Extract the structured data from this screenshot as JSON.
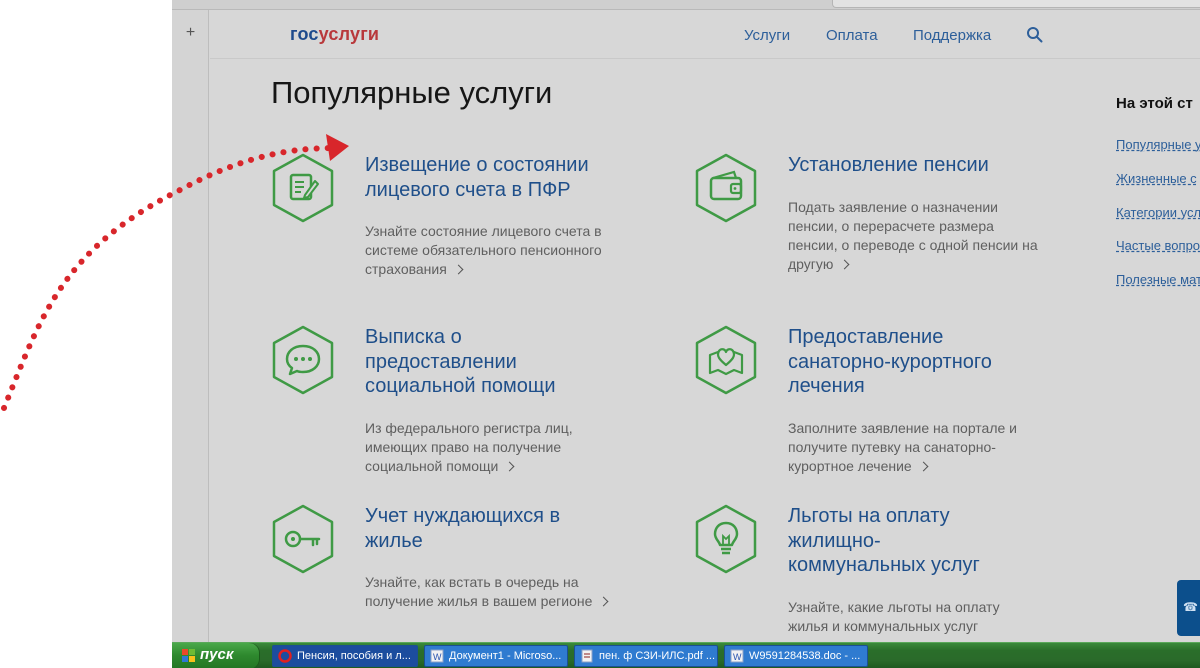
{
  "header": {
    "logo_left": "гос",
    "logo_right": "услуги",
    "nav": [
      "Услуги",
      "Оплата",
      "Поддержка"
    ],
    "search_icon": "search-icon"
  },
  "page_title": "Популярные услуги",
  "cards": [
    {
      "icon": "document-edit-icon",
      "title": "Извещение о состоянии лицевого счета в ПФР",
      "desc": "Узнайте состояние лицевого счета в системе обязательного пенсионного страхования"
    },
    {
      "icon": "wallet-icon",
      "title": "Установление пенсии",
      "desc": "Подать заявление о назначении пенсии, о перерасчете размера пенсии, о переводе с одной пенсии на другую"
    },
    {
      "icon": "chat-bubble-icon",
      "title": "Выписка о предоставлении социальной помощи",
      "desc": "Из федерального регистра лиц, имеющих право на получение социальной помощи"
    },
    {
      "icon": "heart-map-icon",
      "title": "Предоставление санаторно-курортного лечения",
      "desc": "Заполните заявление на портале и получите путевку на санаторно-курортное лечение"
    },
    {
      "icon": "key-icon",
      "title": "Учет нуждающихся в жилье",
      "desc": "Узнайте, как встать в очередь на получение жилья в вашем регионе"
    },
    {
      "icon": "lightbulb-icon",
      "title": "Льготы на оплату жилищно-коммунальных услуг",
      "desc": "Узнайте, какие льготы на оплату жилья и коммунальных услуг предоставляются в вашем регионе,"
    }
  ],
  "sidebar": {
    "heading": "На этой ст",
    "links": [
      "Популярные у",
      "Жизненные с",
      "Категории усл",
      "Частые вопрос",
      "Полезные мат"
    ]
  },
  "taskbar": {
    "start_label": "пуск",
    "tasks": [
      "Пенсия, пособия и л...",
      "Документ1 - Microso...",
      "пен. ф СЗИ-ИЛС.pdf ...",
      "W9591284538.doc - ..."
    ]
  },
  "colors": {
    "accent_blue": "#1f4f8a",
    "icon_green": "#3f9a45",
    "logo_red": "#b8383b",
    "arrow_red": "#d8262b"
  }
}
